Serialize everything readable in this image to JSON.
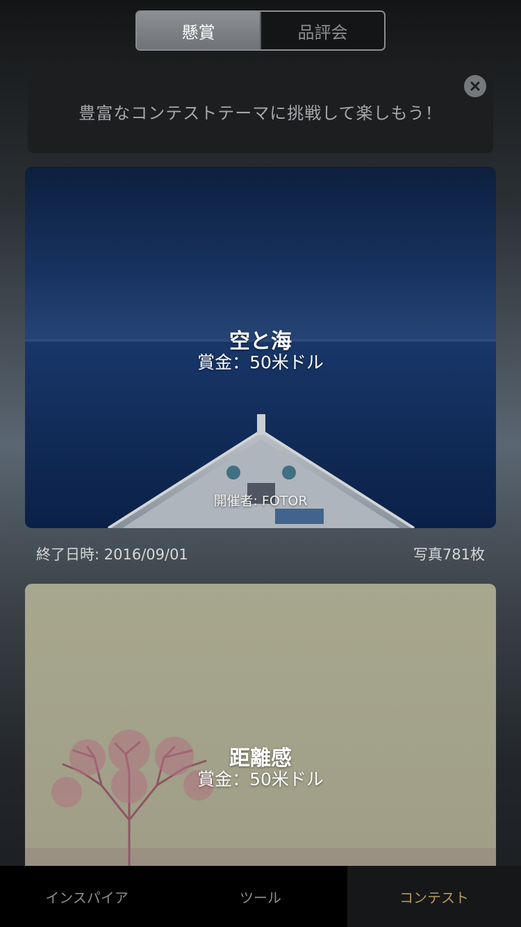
{
  "segmented": {
    "options": [
      "懸賞",
      "品評会"
    ],
    "selected": "懸賞"
  },
  "banner": {
    "text": "豊富なコンテストテーマに挑戦して楽しもう！",
    "close_icon": "close-icon"
  },
  "contests": [
    {
      "title": "空と海",
      "prize": "賞金：50米ドル",
      "organizer": "開催者: FOTOR",
      "end_date": "終了日時: 2016/09/01",
      "photo_count": "写真781枚"
    },
    {
      "title": "距離感",
      "prize": "賞金：50米ドル"
    }
  ],
  "tabbar": {
    "items": [
      "インスパイア",
      "ツール",
      "コンテスト"
    ],
    "active": "コンテスト",
    "active_color": "#b59a5f"
  }
}
